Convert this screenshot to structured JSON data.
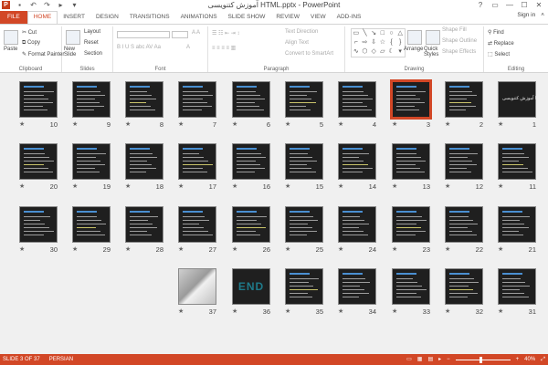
{
  "window": {
    "title": "آموزش کتنویسی HTML.pptx - PowerPoint",
    "app_icon": "P",
    "controls": [
      "?",
      "▭",
      "—",
      "☐",
      "✕"
    ]
  },
  "ribbon_tabs": [
    "FILE",
    "HOME",
    "INSERT",
    "DESIGN",
    "TRANSITIONS",
    "ANIMATIONS",
    "SLIDE SHOW",
    "REVIEW",
    "VIEW",
    "ADD-INS"
  ],
  "active_tab": "HOME",
  "sign_in": "Sign in",
  "clipboard": {
    "label": "Clipboard",
    "paste": "Paste",
    "cut": "Cut",
    "copy": "Copy",
    "format_painter": "Format Painter"
  },
  "slides_group": {
    "label": "Slides",
    "new_slide": "New Slide",
    "layout": "Layout",
    "reset": "Reset",
    "section": "Section"
  },
  "font_group": {
    "label": "Font"
  },
  "paragraph_group": {
    "label": "Paragraph",
    "text_direction": "Text Direction",
    "align_text": "Align Text",
    "convert_smartart": "Convert to SmartArt"
  },
  "drawing_group": {
    "label": "Drawing",
    "arrange": "Arrange",
    "quick_styles": "Quick Styles",
    "shape_fill": "Shape Fill",
    "shape_outline": "Shape Outline",
    "shape_effects": "Shape Effects"
  },
  "editing_group": {
    "label": "Editing",
    "find": "Find",
    "replace": "Replace",
    "select": "Select"
  },
  "slides": [
    {
      "n": "1",
      "kind": "title",
      "title_text": "آموزش کتنویسی HTML"
    },
    {
      "n": "2",
      "kind": "text"
    },
    {
      "n": "3",
      "kind": "text",
      "selected": true
    },
    {
      "n": "4",
      "kind": "text"
    },
    {
      "n": "5",
      "kind": "text"
    },
    {
      "n": "6",
      "kind": "text"
    },
    {
      "n": "7",
      "kind": "text"
    },
    {
      "n": "8",
      "kind": "text"
    },
    {
      "n": "9",
      "kind": "text"
    },
    {
      "n": "10",
      "kind": "text"
    },
    {
      "n": "11",
      "kind": "text"
    },
    {
      "n": "12",
      "kind": "text"
    },
    {
      "n": "13",
      "kind": "text"
    },
    {
      "n": "14",
      "kind": "text"
    },
    {
      "n": "15",
      "kind": "text"
    },
    {
      "n": "16",
      "kind": "text"
    },
    {
      "n": "17",
      "kind": "text"
    },
    {
      "n": "18",
      "kind": "text"
    },
    {
      "n": "19",
      "kind": "text"
    },
    {
      "n": "20",
      "kind": "text"
    },
    {
      "n": "21",
      "kind": "text"
    },
    {
      "n": "22",
      "kind": "text"
    },
    {
      "n": "23",
      "kind": "text"
    },
    {
      "n": "24",
      "kind": "text"
    },
    {
      "n": "25",
      "kind": "text"
    },
    {
      "n": "26",
      "kind": "text"
    },
    {
      "n": "27",
      "kind": "text"
    },
    {
      "n": "28",
      "kind": "text"
    },
    {
      "n": "29",
      "kind": "text"
    },
    {
      "n": "30",
      "kind": "text"
    },
    {
      "n": "31",
      "kind": "text"
    },
    {
      "n": "32",
      "kind": "text"
    },
    {
      "n": "33",
      "kind": "text"
    },
    {
      "n": "34",
      "kind": "text"
    },
    {
      "n": "35",
      "kind": "text"
    },
    {
      "n": "36",
      "kind": "end",
      "title_text": "END"
    },
    {
      "n": "37",
      "kind": "image"
    }
  ],
  "status": {
    "slide_info": "SLIDE 3 OF 37",
    "language": "PERSIAN",
    "zoom": "40%"
  },
  "colors": {
    "accent": "#d24726",
    "sorter_bg": "#f0f0f0"
  }
}
